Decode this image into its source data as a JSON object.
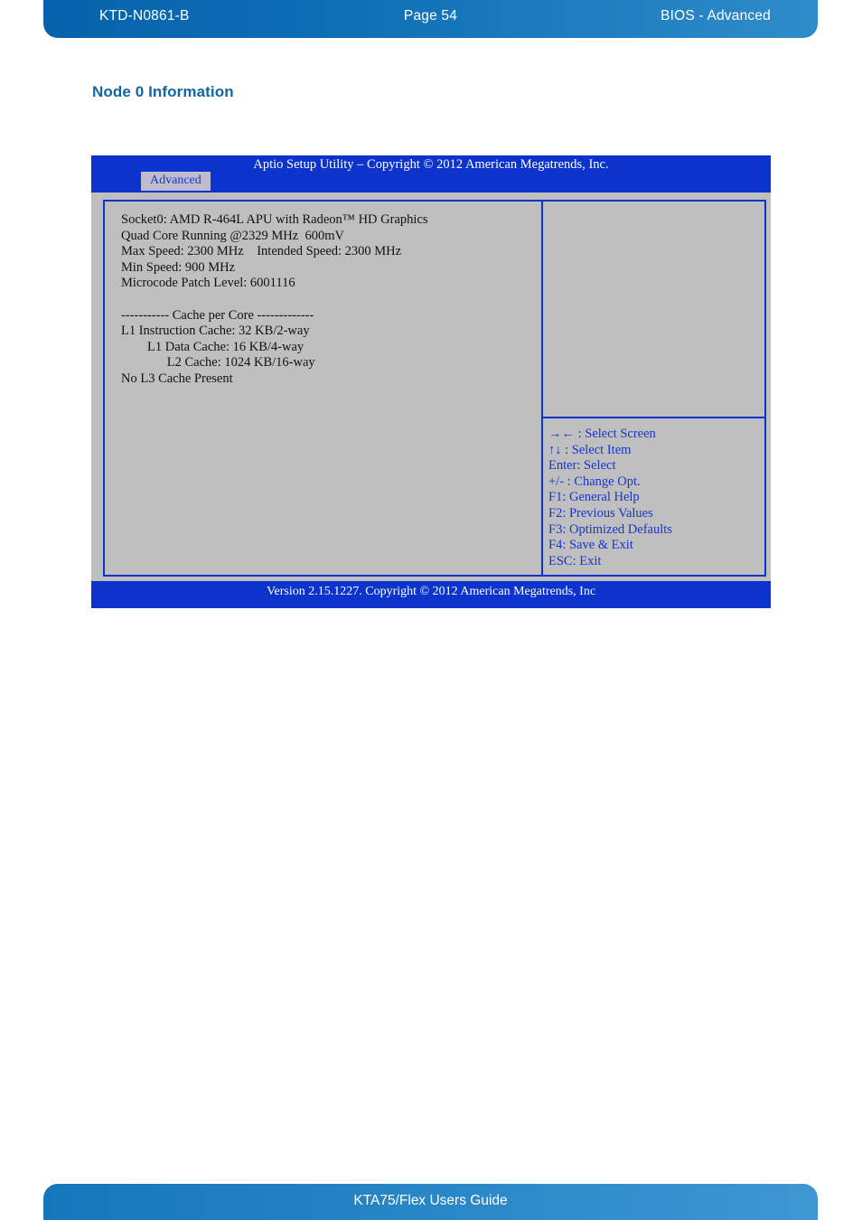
{
  "header": {
    "doc_code": "KTD-N0861-B",
    "page_label": "Page 54",
    "section_label": "BIOS  - Advanced"
  },
  "page_title": "Node 0 Information",
  "bios": {
    "title": "Aptio Setup Utility  –  Copyright © 2012 American Megatrends, Inc.",
    "active_tab": "Advanced",
    "info_lines": [
      "Socket0: AMD R-464L APU with Radeon™ HD Graphics",
      "Quad Core Running @2329 MHz  600mV",
      "Max Speed: 2300 MHz    Intended Speed: 2300 MHz",
      "Min Speed: 900 MHz",
      "Microcode Patch Level: 6001116",
      "",
      "----------- Cache per Core -------------",
      "L1 Instruction Cache: 32 KB/2-way",
      "        L1 Data Cache: 16 KB/4-way",
      "              L2 Cache: 1024 KB/16-way",
      "No L3 Cache Present"
    ],
    "help_lines": [
      "→← : Select Screen",
      "↑↓ : Select Item",
      "Enter: Select",
      "+/- : Change Opt.",
      "F1: General Help",
      "F2: Previous Values",
      "F3: Optimized Defaults",
      "F4: Save & Exit",
      "ESC: Exit"
    ],
    "version": "Version 2.15.1227. Copyright © 2012 American Megatrends, Inc"
  },
  "footer": {
    "guide_title": "KTA75/Flex Users Guide"
  },
  "colors": {
    "header_blue": "#0663ab",
    "title_blue": "#1065a8",
    "bios_blue": "#0c33cc",
    "bios_gray": "#bfbfbf",
    "tab_gray": "#bdbdcf"
  }
}
